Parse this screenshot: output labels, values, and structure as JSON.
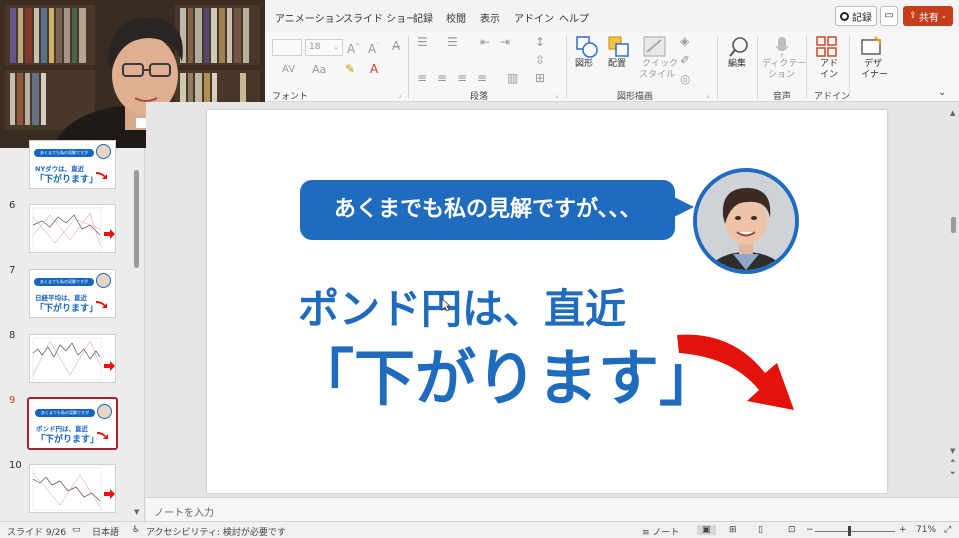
{
  "menu": [
    "アニメーション",
    "スライド ショー",
    "記録",
    "校閲",
    "表示",
    "アドイン",
    "ヘルプ"
  ],
  "header_buttons": {
    "record": "記録",
    "share": "共有"
  },
  "ribbon": {
    "font_size": "18",
    "groups": {
      "font": "フォント",
      "paragraph": "段落",
      "drawing": "図形描画",
      "voice": "音声",
      "addin": "アドイン"
    },
    "buttons": {
      "shapes": "図形",
      "arrange": "配置",
      "quick_style_1": "クイック",
      "quick_style_2": "スタイル",
      "edit": "編集",
      "dictate_1": "ディクテー",
      "dictate_2": "ション",
      "addin_1": "アド",
      "addin_2": "イン",
      "designer_1": "デザ",
      "designer_2": "イナー"
    }
  },
  "thumbnails": [
    {
      "number": "",
      "type": "text",
      "line1": "NYダウは、直近",
      "line2": "「下がります」",
      "bubble": "あくまでも私の見解ですが"
    },
    {
      "number": "6",
      "type": "chart"
    },
    {
      "number": "7",
      "type": "text",
      "line1": "日経平均は、直近",
      "line2": "「下がります」",
      "bubble": "あくまでも私の見解ですが"
    },
    {
      "number": "8",
      "type": "chart"
    },
    {
      "number": "9",
      "type": "text",
      "line1": "ポンド円は、直近",
      "line2": "「下がります」",
      "bubble": "あくまでも私の見解ですが",
      "active": true
    },
    {
      "number": "10",
      "type": "chart"
    }
  ],
  "slide": {
    "bubble_text": "あくまでも私の見解ですが、、、",
    "headline1": "ポンド円は、直近",
    "headline2": "「下がります」",
    "accent_color": "#1f6bbd",
    "arrow_color": "#e3120b"
  },
  "notes_placeholder": "ノートを入力",
  "status": {
    "slide_counter": "スライド 9/26",
    "language": "日本語",
    "accessibility": "アクセシビリティ: 検討が必要です",
    "notes_button": "ノート",
    "zoom": "71%"
  }
}
